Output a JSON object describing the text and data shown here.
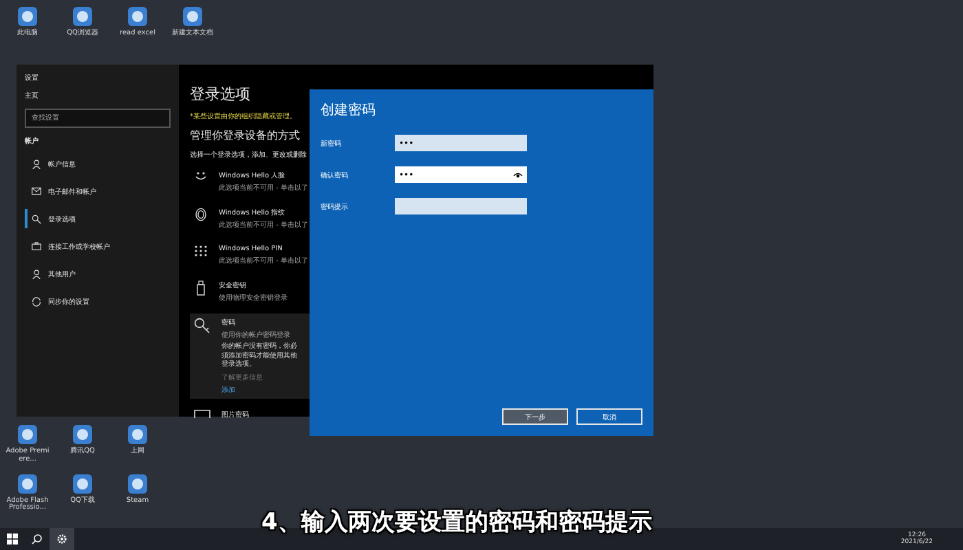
{
  "desktop_icons_top": [
    {
      "label": "此电脑"
    },
    {
      "label": "QQ浏览器"
    },
    {
      "label": "read excel"
    },
    {
      "label": "新建文本文档"
    }
  ],
  "desktop_icons_bottom": [
    {
      "label": "Adobe Premiere..."
    },
    {
      "label": "腾讯QQ"
    },
    {
      "label": "上网"
    },
    {
      "label": "Adobe Flash Professio..."
    },
    {
      "label": "QQ下载"
    },
    {
      "label": "Steam"
    }
  ],
  "settings": {
    "title": "设置",
    "home": "主页",
    "search": {
      "placeholder": "查找设置"
    },
    "section": "帐户",
    "nav": [
      {
        "label": "帐户信息",
        "selected": false
      },
      {
        "label": "电子邮件和帐户",
        "selected": false
      },
      {
        "label": "登录选项",
        "selected": true
      },
      {
        "label": "连接工作或学校帐户",
        "selected": false
      },
      {
        "label": "其他用户",
        "selected": false
      },
      {
        "label": "同步你的设置",
        "selected": false
      }
    ],
    "heading": "登录选项",
    "notice": "*某些设置由你的组织隐藏或管理。",
    "subheading": "管理你登录设备的方式",
    "intro": "选择一个登录选项，添加、更改或删除",
    "options": [
      {
        "title": "Windows Hello 人脸",
        "desc": "此选项当前不可用 - 单击以了",
        "expanded": false
      },
      {
        "title": "Windows Hello 指纹",
        "desc": "此选项当前不可用 - 单击以了",
        "expanded": false
      },
      {
        "title": "Windows Hello PIN",
        "desc": "此选项当前不可用 - 单击以了",
        "expanded": false
      },
      {
        "title": "安全密钥",
        "desc": "使用物理安全密钥登录",
        "expanded": false
      },
      {
        "title": "密码",
        "desc": "使用你的帐户密码登录",
        "expanded": true,
        "detail": "你的帐户没有密码，你必须添加密码才能使用其他登录选项。",
        "more": "了解更多信息",
        "link": "添加"
      },
      {
        "title": "图片密码",
        "expanded": false
      }
    ]
  },
  "dialog": {
    "title": "创建密码",
    "fields": [
      {
        "label": "新密码",
        "value": "•••",
        "focused": false
      },
      {
        "label": "确认密码",
        "value": "•••",
        "focused": true
      },
      {
        "label": "密码提示",
        "focused": false
      }
    ],
    "buttons": [
      {
        "label": "下一步",
        "primary": true
      },
      {
        "label": "取消",
        "primary": false
      }
    ]
  },
  "taskbar": {
    "time": "12:26",
    "date": "2021/6/22"
  },
  "caption": "4、输入两次要设置的密码和密码提示"
}
